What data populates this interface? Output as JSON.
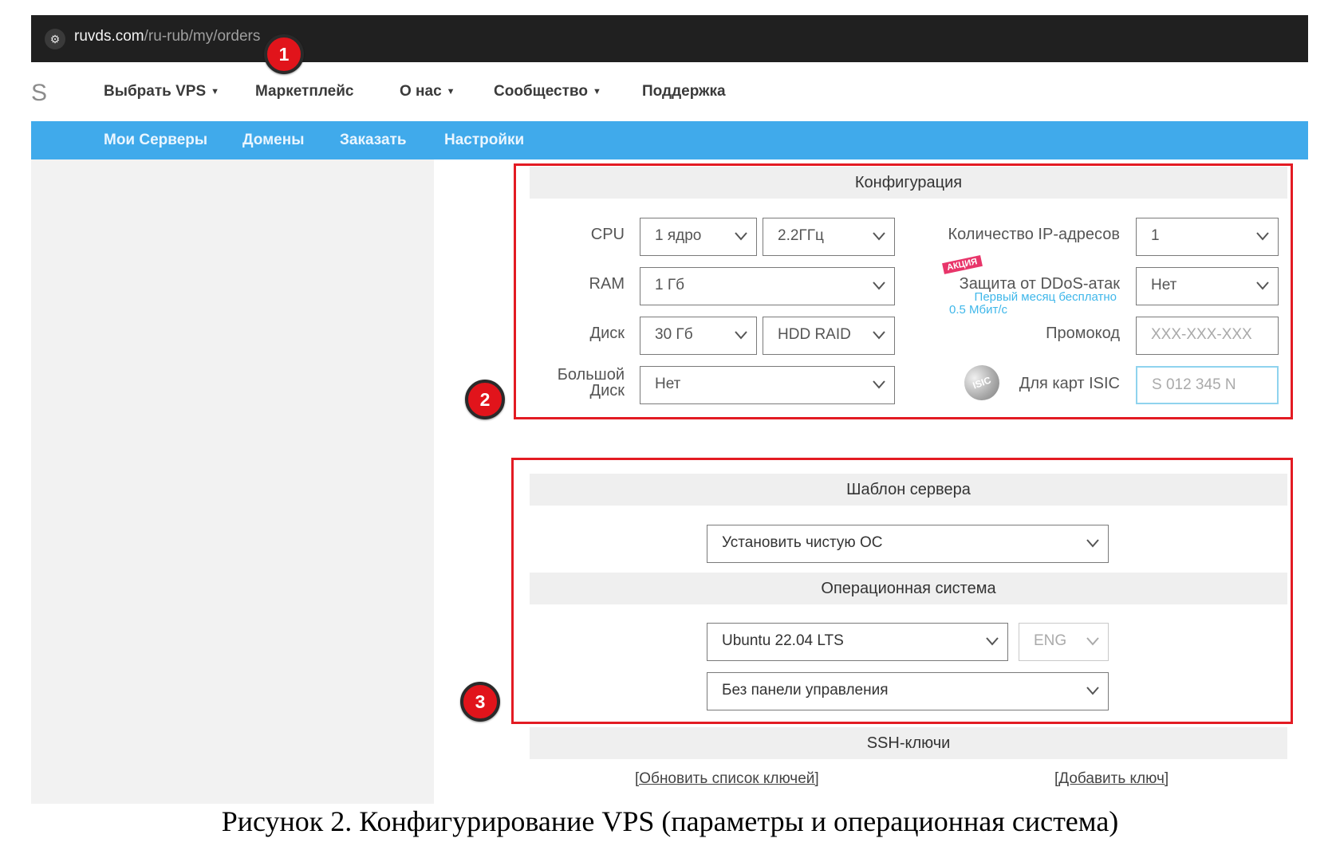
{
  "browser": {
    "url_host": "ruvds.com",
    "url_path": "/ru-rub/my/orders"
  },
  "markers": [
    "1",
    "2",
    "3"
  ],
  "logo_fragment": "S",
  "topnav": {
    "items": [
      "Выбрать VPS",
      "Маркетплейс",
      "О нас",
      "Сообщество",
      "Поддержка"
    ]
  },
  "subnav": {
    "items": [
      "Мои Серверы",
      "Домены",
      "Заказать",
      "Настройки"
    ]
  },
  "config": {
    "title": "Конфигурация",
    "cpu_label": "CPU",
    "cpu_cores": "1 ядро",
    "cpu_freq": "2.2ГГц",
    "ram_label": "RAM",
    "ram_value": "1 Гб",
    "disk_label": "Диск",
    "disk_size": "30 Гб",
    "disk_type": "HDD RAID",
    "bigdisk_label_1": "Большой",
    "bigdisk_label_2": "Диск",
    "bigdisk_value": "Нет",
    "ip_label": "Количество IP-адресов",
    "ip_value": "1",
    "promo_badge": "АКЦИЯ",
    "ddos_label": "Защита от DDoS-атак",
    "ddos_note_1": "Первый месяц бесплатно",
    "ddos_note_2": "0.5 Мбит/с",
    "ddos_value": "Нет",
    "promocode_label": "Промокод",
    "promocode_placeholder": "XXX-XXX-XXX",
    "isic_icon_text": "ISIC",
    "isic_label": "Для карт ISIC",
    "isic_placeholder": "S 012 345 N"
  },
  "template": {
    "title": "Шаблон сервера",
    "value": "Установить чистую ОС"
  },
  "os": {
    "title": "Операционная система",
    "value": "Ubuntu 22.04 LTS",
    "lang": "ENG",
    "panel": "Без панели управления"
  },
  "ssh": {
    "title": "SSH-ключи",
    "refresh_link": "[Обновить список ключей]",
    "add_link": "[Добавить ключ]"
  },
  "caption": "Рисунок 2. Конфигурирование VPS (параметры и операционная система)"
}
